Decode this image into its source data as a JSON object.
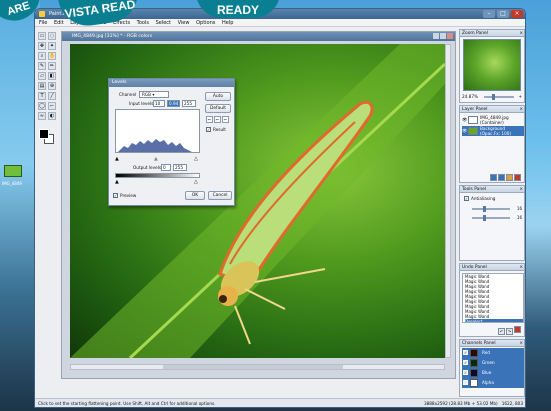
{
  "badges": [
    "ARE",
    "VISTA READ",
    "READY"
  ],
  "desktop": {
    "icon_label": "IMG_4849"
  },
  "window": {
    "title": "Paint.NET Studio 1.0",
    "menu": [
      "File",
      "Edit",
      "Layer",
      "Colors",
      "Effects",
      "Tools",
      "Select",
      "View",
      "Options",
      "Help"
    ]
  },
  "document": {
    "title": "IMG_4849.jpg [31%] * - RGB colors"
  },
  "levels_dialog": {
    "title": "Levels",
    "channel_label": "Channel",
    "channel_value": "RGB",
    "input_levels_label": "Input levels",
    "input_low": "10",
    "input_mid": "0.94",
    "input_high": "255",
    "output_levels_label": "Output levels",
    "output_low": "0",
    "output_high": "255",
    "auto_label": "Auto",
    "default_label": "Default",
    "result_label": "Result",
    "result_checked": true,
    "preview_label": "Preview",
    "preview_checked": true,
    "ok_label": "OK",
    "cancel_label": "Cancel"
  },
  "zoom_panel": {
    "title": "Zoom Panel",
    "zoom_value": "24.87%",
    "zoom_level": 0.25
  },
  "layer_panel": {
    "title": "Layer Panel",
    "layers": [
      {
        "name": "IMG_4849.jpg",
        "sub": "(Container)",
        "selected": false,
        "color": "#ffffff"
      },
      {
        "name": "Background",
        "sub": "(Opac.Fx: 100)",
        "selected": true,
        "color": "#6da52c"
      }
    ]
  },
  "tools_panel": {
    "title": "Tools Panel",
    "antialiasing_label": "Antialiasing",
    "antialiasing_checked": true,
    "sliders": [
      {
        "value": "16",
        "level": 0.3
      },
      {
        "value": "16",
        "level": 0.3
      }
    ]
  },
  "undo_panel": {
    "title": "Undo Panel",
    "items": [
      "Magic Wand",
      "Magic Wand",
      "Magic Wand",
      "Magic Wand",
      "Magic Wand",
      "Magic Wand",
      "Magic Wand",
      "Magic Wand",
      "Magic Wand",
      "Deselect"
    ],
    "selected_index": 9
  },
  "channels_panel": {
    "title": "Channels Panel",
    "channels": [
      {
        "name": "Red",
        "selected": true,
        "color": "#2a0a0a"
      },
      {
        "name": "Green",
        "selected": true,
        "color": "#0a2a0a"
      },
      {
        "name": "Blue",
        "selected": true,
        "color": "#0a0a2a"
      },
      {
        "name": "Alpha",
        "selected": false,
        "color": "#ffffff"
      }
    ]
  },
  "statusbar": {
    "hint": "Click to set the starting flattening point. Use Shift, Alt and Ctrl for additional options.",
    "info": "3888x2592 (28.83 Mb + 53.02 Mb)",
    "coords": "1622, 803"
  },
  "colors": {
    "accent": "#3b73b9",
    "titlebar": "#3b6690",
    "badge": "#0b7f92"
  }
}
